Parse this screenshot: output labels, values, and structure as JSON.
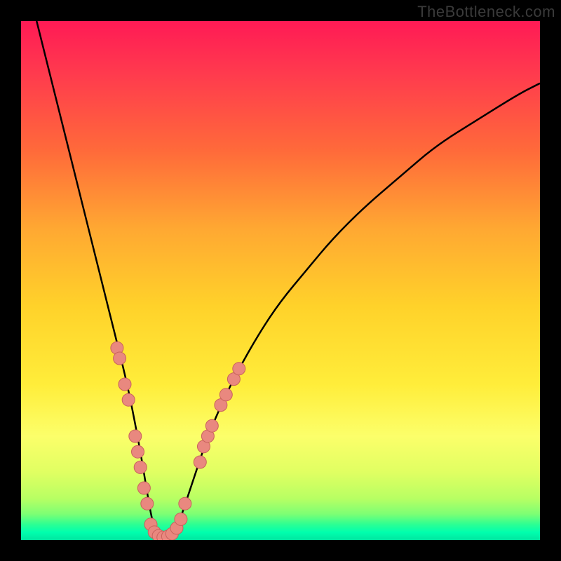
{
  "watermark": "TheBottleneck.com",
  "colors": {
    "curve": "#000000",
    "marker_fill": "#e9887f",
    "marker_stroke": "#c9625d",
    "frame": "#000000"
  },
  "chart_data": {
    "type": "line",
    "title": "",
    "xlabel": "",
    "ylabel": "",
    "xlim": [
      0,
      100
    ],
    "ylim": [
      0,
      100
    ],
    "grid": false,
    "series": [
      {
        "name": "bottleneck-curve",
        "x": [
          3,
          5,
          8,
          10,
          12,
          14,
          16,
          18,
          20,
          21.5,
          23,
          24,
          25,
          26,
          27,
          29,
          30,
          32,
          34,
          36,
          39,
          42,
          46,
          50,
          55,
          60,
          66,
          73,
          80,
          88,
          96,
          100
        ],
        "y": [
          100,
          92,
          80,
          72,
          64,
          56,
          48,
          40,
          32,
          25,
          17,
          11,
          5,
          1,
          0,
          0,
          2,
          8,
          14,
          20,
          27,
          33,
          40,
          46,
          52,
          58,
          64,
          70,
          76,
          81,
          86,
          88
        ]
      }
    ],
    "markers": [
      {
        "x": 18.5,
        "y": 37
      },
      {
        "x": 19.0,
        "y": 35
      },
      {
        "x": 20.0,
        "y": 30
      },
      {
        "x": 20.7,
        "y": 27
      },
      {
        "x": 22.0,
        "y": 20
      },
      {
        "x": 22.5,
        "y": 17
      },
      {
        "x": 23.0,
        "y": 14
      },
      {
        "x": 23.7,
        "y": 10
      },
      {
        "x": 24.3,
        "y": 7
      },
      {
        "x": 25.0,
        "y": 3
      },
      {
        "x": 25.7,
        "y": 1.5
      },
      {
        "x": 26.5,
        "y": 0.8
      },
      {
        "x": 27.4,
        "y": 0.5
      },
      {
        "x": 28.3,
        "y": 0.7
      },
      {
        "x": 29.1,
        "y": 1.2
      },
      {
        "x": 30.0,
        "y": 2.3
      },
      {
        "x": 30.8,
        "y": 4
      },
      {
        "x": 31.6,
        "y": 7
      },
      {
        "x": 34.5,
        "y": 15
      },
      {
        "x": 35.2,
        "y": 18
      },
      {
        "x": 36.0,
        "y": 20
      },
      {
        "x": 36.8,
        "y": 22
      },
      {
        "x": 38.5,
        "y": 26
      },
      {
        "x": 39.5,
        "y": 28
      },
      {
        "x": 41.0,
        "y": 31
      },
      {
        "x": 42.0,
        "y": 33
      }
    ],
    "marker_radius": 9
  }
}
